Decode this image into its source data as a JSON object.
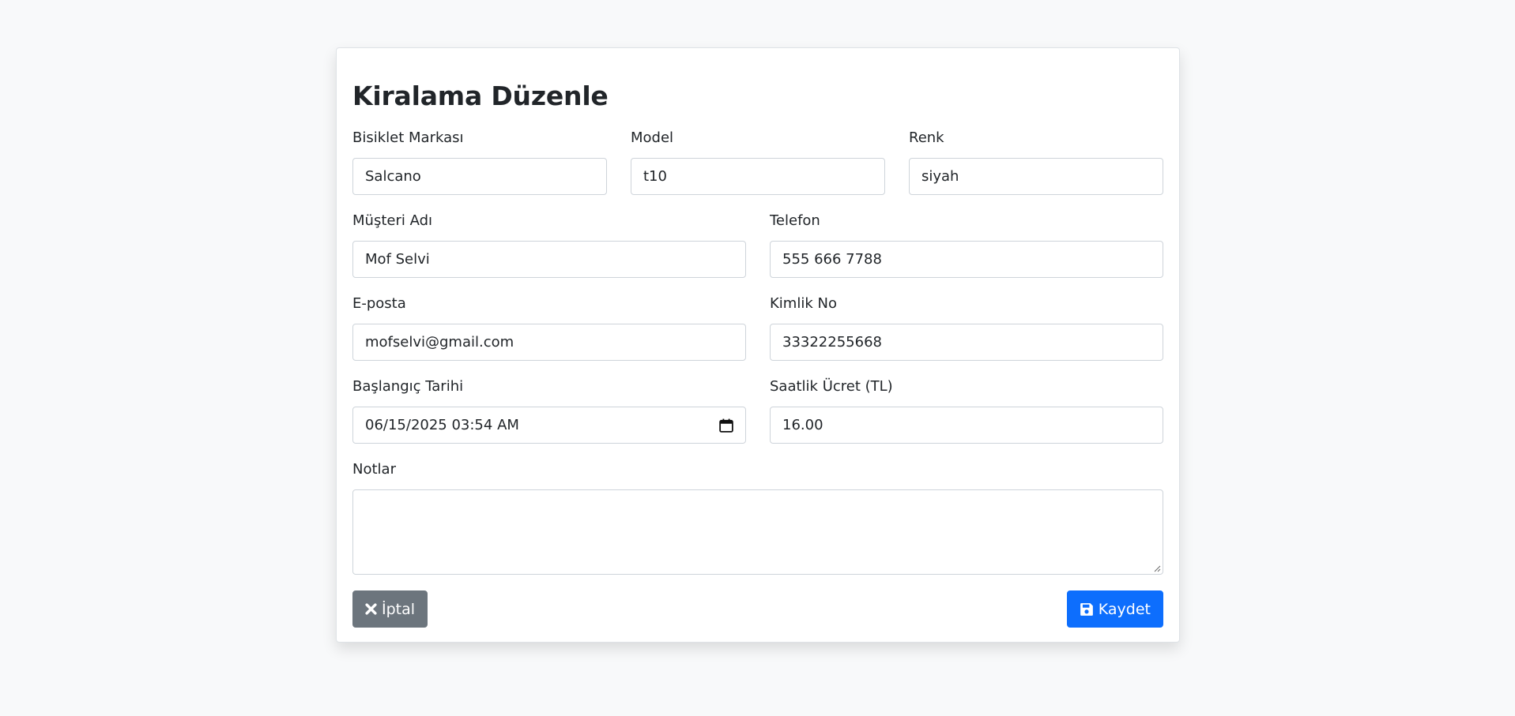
{
  "form": {
    "title": "Kiralama Düzenle",
    "brand": {
      "label": "Bisiklet Markası",
      "value": "Salcano"
    },
    "model": {
      "label": "Model",
      "value": "t10"
    },
    "color": {
      "label": "Renk",
      "value": "siyah"
    },
    "customer_name": {
      "label": "Müşteri Adı",
      "value": "Mof Selvi"
    },
    "phone": {
      "label": "Telefon",
      "value": "555 666 7788"
    },
    "email": {
      "label": "E-posta",
      "value": "mofselvi@gmail.com"
    },
    "id_no": {
      "label": "Kimlik No",
      "value": "33322255668"
    },
    "start_date": {
      "label": "Başlangıç Tarihi",
      "value": "06/15/2025 03:54 AM",
      "icon": "calendar-icon"
    },
    "hourly_rate": {
      "label": "Saatlik Ücret (TL)",
      "value": "16.00"
    },
    "notes": {
      "label": "Notlar",
      "value": ""
    }
  },
  "actions": {
    "cancel_label": "İptal",
    "cancel_icon": "close-icon",
    "save_label": "Kaydet",
    "save_icon": "save-icon"
  },
  "colors": {
    "background": "#f8f9fa",
    "primary": "#0d6efd",
    "secondary": "#6c757d",
    "border": "#ced4da"
  }
}
